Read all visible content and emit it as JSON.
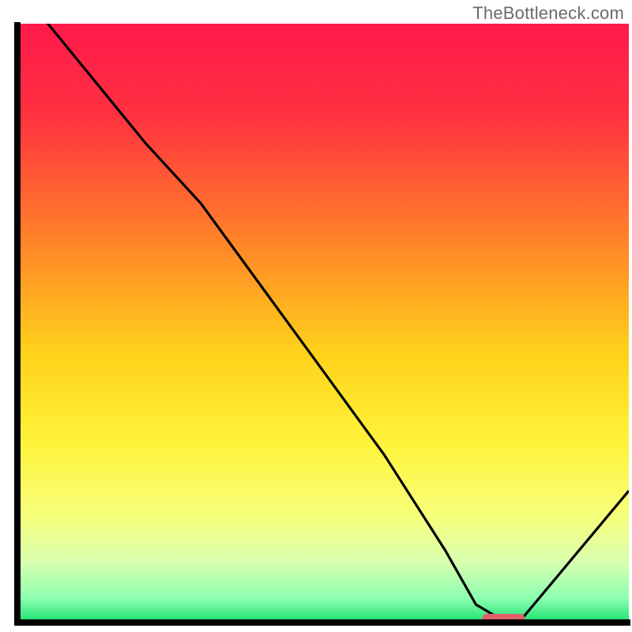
{
  "watermark": "TheBottleneck.com",
  "chart_data": {
    "type": "line",
    "title": "",
    "xlabel": "",
    "ylabel": "",
    "xlim": [
      0,
      100
    ],
    "ylim": [
      0,
      100
    ],
    "x": [
      0,
      5,
      21,
      30,
      40,
      50,
      60,
      70,
      75,
      80,
      82,
      100
    ],
    "values": [
      105,
      100,
      80,
      70,
      56,
      42,
      28,
      12,
      3,
      0,
      0,
      22
    ],
    "optimal_marker": {
      "x_start": 76,
      "x_end": 83,
      "y": 0
    },
    "gradient_stops": [
      {
        "offset": 0.0,
        "color": "#ff1a4b"
      },
      {
        "offset": 0.15,
        "color": "#ff3040"
      },
      {
        "offset": 0.35,
        "color": "#ff7e2a"
      },
      {
        "offset": 0.55,
        "color": "#ffd21a"
      },
      {
        "offset": 0.7,
        "color": "#fff33a"
      },
      {
        "offset": 0.82,
        "color": "#f7ff7a"
      },
      {
        "offset": 0.9,
        "color": "#d8ffb0"
      },
      {
        "offset": 0.96,
        "color": "#8cffb0"
      },
      {
        "offset": 1.0,
        "color": "#18e070"
      }
    ],
    "colors": {
      "axis": "#000000",
      "curve": "#000000",
      "marker": "#e0606a"
    }
  }
}
